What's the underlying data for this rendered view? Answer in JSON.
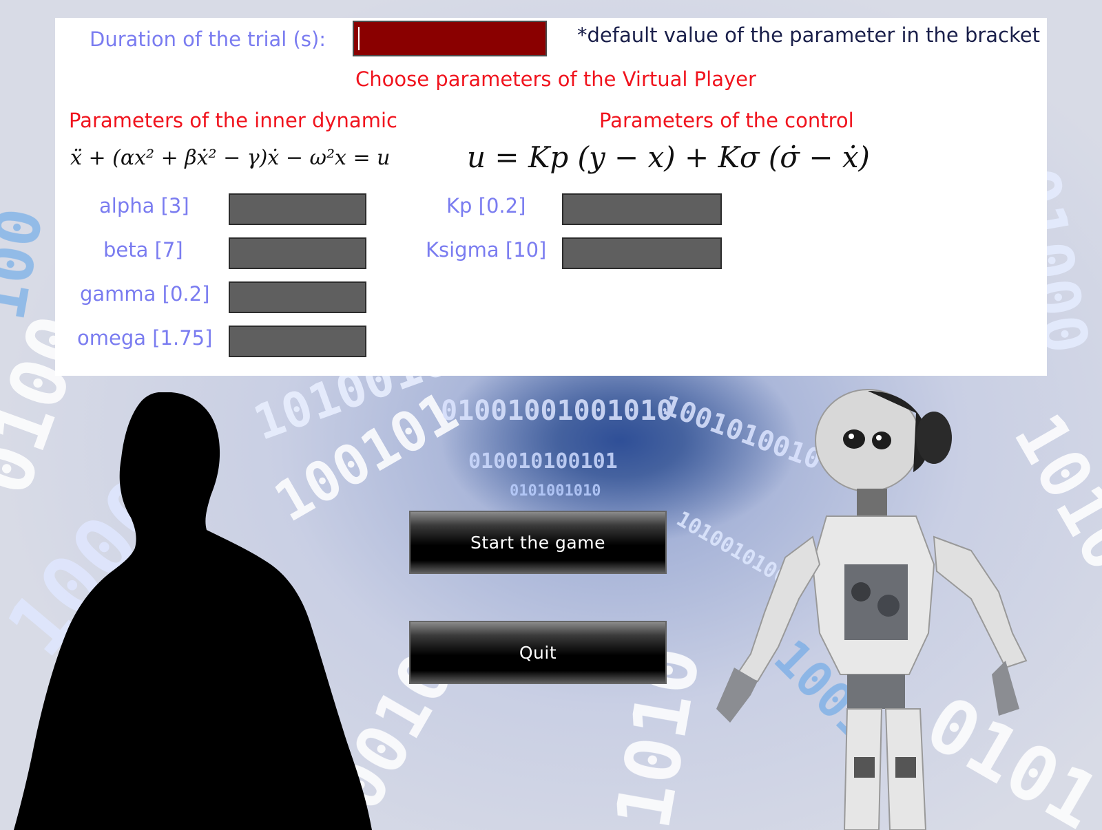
{
  "panel": {
    "duration_label": "Duration of the trial (s):",
    "duration_value": "",
    "default_note": "*default value of the parameter in the bracket",
    "choose_title": "Choose parameters of the Virtual Player",
    "inner_dynamic_title": "Parameters of the inner dynamic",
    "control_title": "Parameters of the control",
    "inner_formula": "ẍ + (αx² + βẋ² − γ)ẋ − ω²x = u",
    "control_formula": "u = Kp (y − x) + Kσ (σ̇ − ẋ)",
    "inner_params": [
      {
        "label": "alpha [3]",
        "value": ""
      },
      {
        "label": "beta [7]",
        "value": ""
      },
      {
        "label": "gamma [0.2]",
        "value": ""
      },
      {
        "label": "omega [1.75]",
        "value": ""
      }
    ],
    "control_params": [
      {
        "label": "Kp [0.2]",
        "value": ""
      },
      {
        "label": "Ksigma [10]",
        "value": ""
      }
    ]
  },
  "buttons": {
    "start": "Start the game",
    "quit": "Quit"
  },
  "colors": {
    "label_blue": "#7a7cf0",
    "title_red": "#f0141e",
    "duration_field": "#8a0000",
    "param_field": "#5f5f5f"
  }
}
